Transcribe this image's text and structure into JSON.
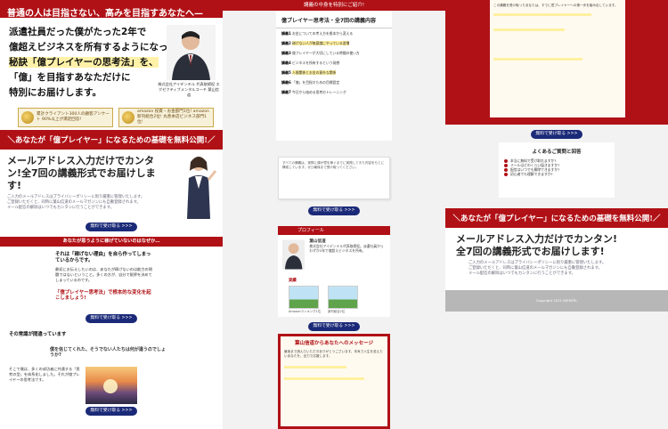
{
  "column1": {
    "hero_bar": "普通の人は目指さない、高みを目指すあなたへ—",
    "hero_lines": [
      "派遣社員だった僕がたった2年で",
      "億超えビジネスを所有するようになった",
      "秘訣「億プレイヤーの思考法」を、",
      "「億」を目指すあなただけに",
      "特別にお届けします。"
    ],
    "hero_caption": "株式会社アイデンテル 代表取締役 エグゼクティブメンタルコーチ 葉山信道",
    "badges": [
      "累計クライアント300人の顧客アンケート 90%以上が満足回答!",
      "amazon 投資・お金部門1位! amazon 新刊総合2位! 丸善本店ビジネス部門1位!"
    ],
    "free_banner": "＼あなたが「億プレイヤー」になるための基礎を無料公開!／",
    "mail_title": "メールアドレス入力だけでカンタン!全7回の講義形式でお届けします!",
    "mail_notes": [
      "ご入力のメールアドレスはプライバシーポリシーに則り厳重に管理いたします。",
      "ご登録いただくと、同時に葉山信道のメールマガジンにも自動登録されます。",
      "メール配信の解除はいつでもカンタンに行うことができます。"
    ],
    "button_label": "無料で受け取る >>>",
    "band_text": "あなたが思うように稼げていないのはなぜか…",
    "reason_heading": "それは「稼げない理由」を自ら作ってしまっているからです。",
    "reason_body": "最初にお伝えしたいのは、あなたが稼げないのは能力の問題ではないということ。多くの方が、自分で限界を決めてしまっているのです。",
    "oku_heading": "「億プレイヤー思考法」で根本的な変化を起こしましょう!",
    "era_heading": "その常識が間違っています",
    "era_question": "僕を信じてくれた、そうでない人たちは何が違うのでしょうか?",
    "era_body": "そこで僕は、多くの成功者に共通する「思考の型」を体系化しました。それが億プレイヤーの思考法です。"
  },
  "column2": {
    "head_band": "講義の中身を特別にご紹介!",
    "card_title": "億プレイヤー思考法・全7回の講義内容",
    "lectures": [
      {
        "title": "講義1",
        "text": "お金についての考え方を根本から変える"
      },
      {
        "title": "講義2",
        "text": "稼げない人が無意識にやっている習慣"
      },
      {
        "title": "講義3",
        "text": "億プレイヤーが大切にしている時間の使い方"
      },
      {
        "title": "講義4",
        "text": "ビジネスを所有するという発想"
      },
      {
        "title": "講義5",
        "text": "人間関係とお金の意外な関係"
      },
      {
        "title": "講義6",
        "text": "「億」を目指すための目標設定"
      },
      {
        "title": "講義7",
        "text": "今日から始める思考のトレーニング"
      }
    ],
    "note_text": "すべての講義は、実際に僕が億を稼ぐまでに実践してきた内容をもとに構成しています。ぜひ最後まで受け取ってください。",
    "profile_head": "プロフィール",
    "profile_name": "葉山信道",
    "profile_body": "株式会社アイデンテル代表取締役。派遣社員からわずか2年で億超えビジネスを所有。",
    "photos_title": "実績",
    "photo_captions": [
      "Amazonランキング1位",
      "新刊総合2位"
    ],
    "message_title": "葉山信道からあなたへのメッセージ",
    "message_body": "最後まで読んでいただきありがとうございます。本気で人生を変えたいあなたを、全力で応援します。"
  },
  "column3": {
    "letter_body": "この講義を受け取ったあなたは、すでに億プレイヤーへの第一歩を踏み出しています。",
    "faq_title": "よくあるご質問と回答",
    "faq_items": [
      "本当に無料で受け取れますか?",
      "メールはどのくらい届きますか?",
      "配信はいつでも解除できますか?",
      "初心者でも理解できますか?"
    ],
    "free_banner": "＼あなたが「億プレイヤー」になるための基礎を無料公開!／",
    "mail_title": "メールアドレス入力だけでカンタン!全7回の講義形式でお届けします!",
    "mail_notes": [
      "ご入力のメールアドレスはプライバシーポリシーに則り厳重に管理いたします。",
      "ご登録いただくと、同時に葉山信道のメールマガジンにも自動登録されます。",
      "メール配信の解除はいつでもカンタンに行うことができます。"
    ],
    "button_label": "無料で受け取る >>>",
    "footer": "Copyright 2021 IDENTEL"
  }
}
